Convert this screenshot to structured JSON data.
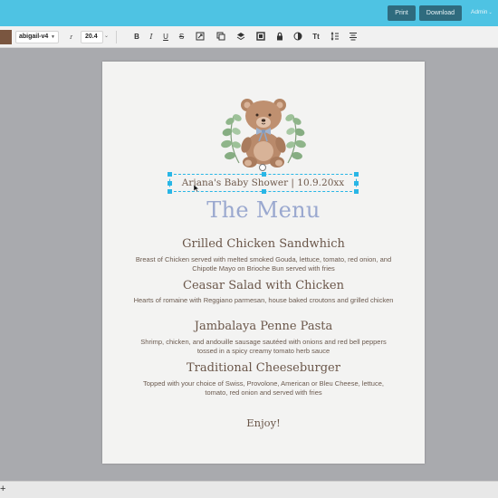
{
  "topbar": {
    "print_label": "Print",
    "download_label": "Download",
    "user_label": "Admin",
    "accent_color": "#4ec3e3"
  },
  "toolbar": {
    "font_name": "abigail-v4",
    "font_size": "20.4",
    "color_swatch": "#7a5640",
    "tools": [
      "text-style-icon",
      "bold-icon",
      "italic-icon",
      "underline-icon",
      "strikethrough-icon",
      "resize-icon",
      "copy-icon",
      "layers-icon",
      "frame-icon",
      "lock-icon",
      "opacity-icon",
      "text-case-icon",
      "line-spacing-icon",
      "align-icon"
    ]
  },
  "menu": {
    "subtitle": "Ariana's Baby Shower | 10.9.20xx",
    "title": "The Menu",
    "title_color": "#9aa8cf",
    "items": [
      {
        "name": "Grilled Chicken Sandwhich",
        "desc": "Breast of Chicken served with melted smoked Gouda, lettuce, tomato, red onion, and Chipotle Mayo on Brioche Bun served with fries"
      },
      {
        "name": "Ceasar Salad with Chicken",
        "desc": "Hearts of romaine with Reggiano parmesan, house baked croutons and grilled chicken"
      },
      {
        "name": "Jambalaya Penne Pasta",
        "desc": "Shrimp, chicken, and andouille sausage sautéed with onions and red bell peppers tossed in a spicy creamy tomato herb sauce"
      },
      {
        "name": "Traditional Cheeseburger",
        "desc": "Topped with your choice of Swiss, Provolone, American or Bleu Cheese, lettuce, tomato, red onion and served with fries"
      }
    ],
    "closing": "Enjoy!"
  },
  "bottombar": {
    "add_label": "+"
  }
}
